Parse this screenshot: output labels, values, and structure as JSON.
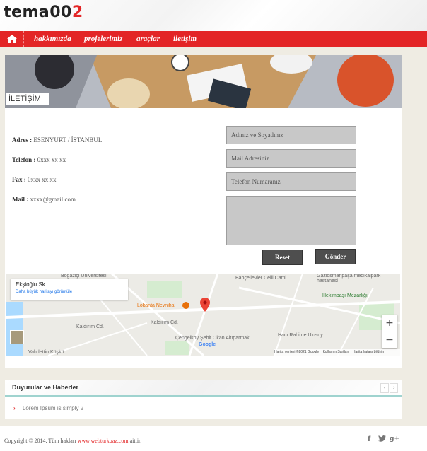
{
  "header": {
    "logo_main": "tema00",
    "logo_accent": "2"
  },
  "nav": {
    "items": [
      {
        "label": "hakkımızda"
      },
      {
        "label": "projelerimiz"
      },
      {
        "label": "araçlar"
      },
      {
        "label": "iletişim"
      }
    ],
    "colors": {
      "bar": "#e32526"
    }
  },
  "page": {
    "title": "İLETİŞİM"
  },
  "contact_info": {
    "address_label": "Adres :",
    "address_value": "ESENYURT / İSTANBUL",
    "phone_label": "Telefon :",
    "phone_value": "0xxx xx xx",
    "fax_label": "Fax :",
    "fax_value": "0xxx xx xx",
    "mail_label": "Mail :",
    "mail_value": "xxxx@gmail.com"
  },
  "form": {
    "name_placeholder": "Adınız ve Soyadınız",
    "mail_placeholder": "Mail Adresiniz",
    "phone_placeholder": "Telefon Numaranız",
    "reset_label": "Reset",
    "submit_label": "Gönder"
  },
  "map": {
    "place_name": "Ekşioğlu Sk.",
    "larger_map_link": "Daha büyük haritayı görüntüle",
    "labels": {
      "university": "Boğaziçi Üniversitesi",
      "cafe": "Bahçelievler Celil Cami",
      "hospital": "Gaziosmanpaşa medikalpark hastanesi",
      "cemetery": "Hekimbaşı Mezarlığı",
      "restaurant": "Lokanta Nevnihal",
      "road1": "Kaldırım Cd.",
      "road2": "Kaldırım Cd.",
      "mosque": "Çengelköy Şehit Okan Altıparmak",
      "hospital2": "Hacı Rahime Ulusoy",
      "school": "Vahdettin Köşkü",
      "attribution": "Harita verileri ©2021 Google",
      "terms": "Kullanım Şartları",
      "report": "Harita hatası bildirin",
      "google": "Google"
    },
    "zoom_in": "+",
    "zoom_out": "−"
  },
  "announcements": {
    "title": "Duyurular ve Haberler",
    "items": [
      {
        "text": "Lorem Ipsum is simply 2"
      }
    ],
    "prev_icon": "chevron-left-icon",
    "next_icon": "chevron-right-icon"
  },
  "footer": {
    "copyright_prefix": "Copyright © 2014. Tüm hakları",
    "copyright_link": "www.webturkuaz.com",
    "copyright_suffix": "aittir.",
    "social_icons": [
      "facebook-icon",
      "twitter-icon",
      "google-plus-icon"
    ]
  }
}
